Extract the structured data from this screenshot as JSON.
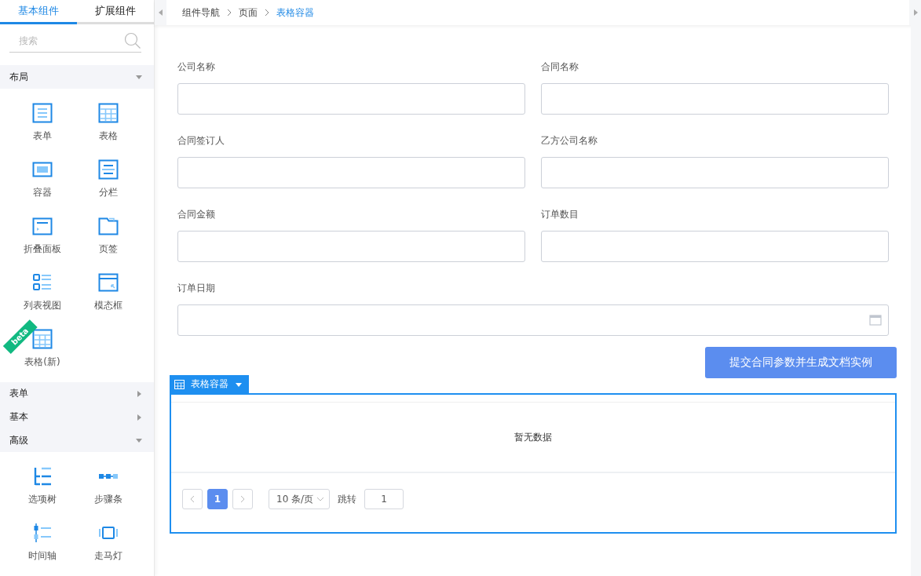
{
  "sidebar": {
    "tabs": [
      {
        "label": "基本组件",
        "selected": true
      },
      {
        "label": "扩展组件",
        "selected": false
      }
    ],
    "search": {
      "placeholder": "搜索"
    },
    "sections": [
      {
        "title": "布局",
        "expanded": true,
        "items": [
          {
            "kind": "form",
            "label": "表单"
          },
          {
            "kind": "table",
            "label": "表格"
          },
          {
            "kind": "container",
            "label": "容器"
          },
          {
            "kind": "columns",
            "label": "分栏"
          },
          {
            "kind": "collapse",
            "label": "折叠面板"
          },
          {
            "kind": "tabs",
            "label": "页签"
          },
          {
            "kind": "list",
            "label": "列表视图"
          },
          {
            "kind": "modal",
            "label": "模态框"
          },
          {
            "kind": "table",
            "label": "表格(新)",
            "badge": "beta"
          }
        ]
      },
      {
        "title": "表单",
        "expanded": false
      },
      {
        "title": "基本",
        "expanded": false
      },
      {
        "title": "高级",
        "expanded": true,
        "items": [
          {
            "kind": "tree",
            "label": "选项树"
          },
          {
            "kind": "steps",
            "label": "步骤条"
          },
          {
            "kind": "timeline",
            "label": "时间轴"
          },
          {
            "kind": "carousel",
            "label": "走马灯"
          }
        ]
      }
    ]
  },
  "breadcrumb": [
    {
      "label": "组件导航",
      "selected": false
    },
    {
      "label": "页面",
      "selected": false
    },
    {
      "label": "表格容器",
      "selected": true
    }
  ],
  "form": {
    "fields": [
      {
        "label": "公司名称",
        "kind": "text"
      },
      {
        "label": "合同名称",
        "kind": "text"
      },
      {
        "label": "合同签订人",
        "kind": "text"
      },
      {
        "label": "乙方公司名称",
        "kind": "text"
      },
      {
        "label": "合同金额",
        "kind": "text"
      },
      {
        "label": "订单数目",
        "kind": "text"
      },
      {
        "label": "订单日期",
        "kind": "date"
      }
    ],
    "submit": "提交合同参数并生成文档实例"
  },
  "table_container": {
    "title": "表格容器",
    "empty_text": "暂无数据",
    "pagination": {
      "pages": [
        {
          "label": "1",
          "selected": true
        }
      ],
      "page_size": "10 条/页",
      "jump_label": "跳转",
      "jump_value": "1"
    }
  }
}
